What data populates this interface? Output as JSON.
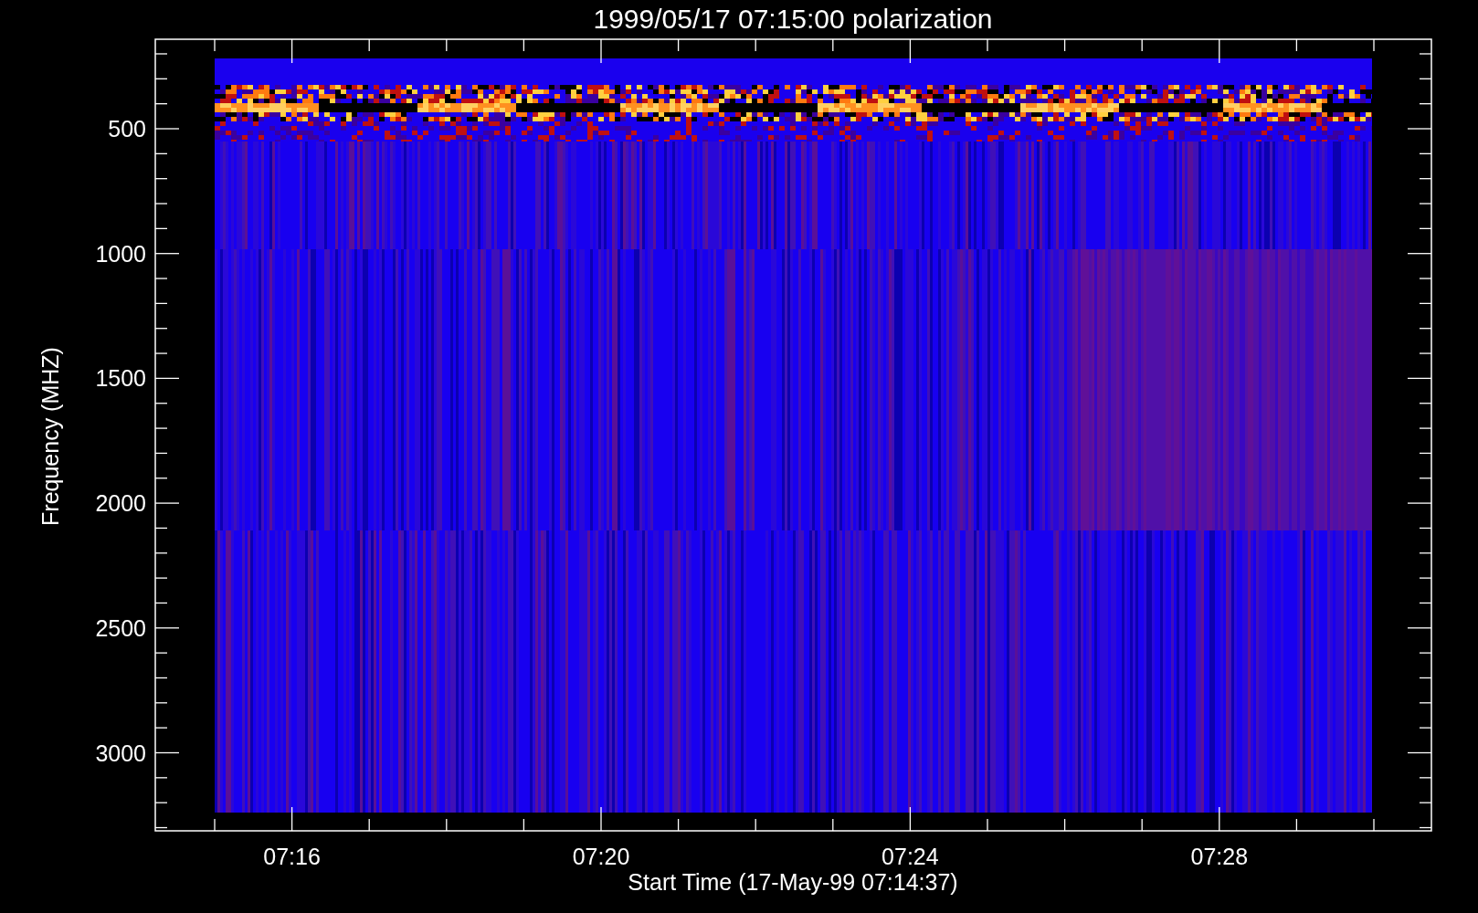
{
  "title": "1999/05/17 07:15:00 polarization",
  "y_axis": {
    "label": "Frequency (MHZ)",
    "tick_labels": [
      "500",
      "1000",
      "1500",
      "2000",
      "2500",
      "3000"
    ]
  },
  "x_axis": {
    "label": "Start Time (17-May-99 07:14:37)",
    "tick_labels": [
      "07:16",
      "07:20",
      "07:24",
      "07:28"
    ]
  }
}
